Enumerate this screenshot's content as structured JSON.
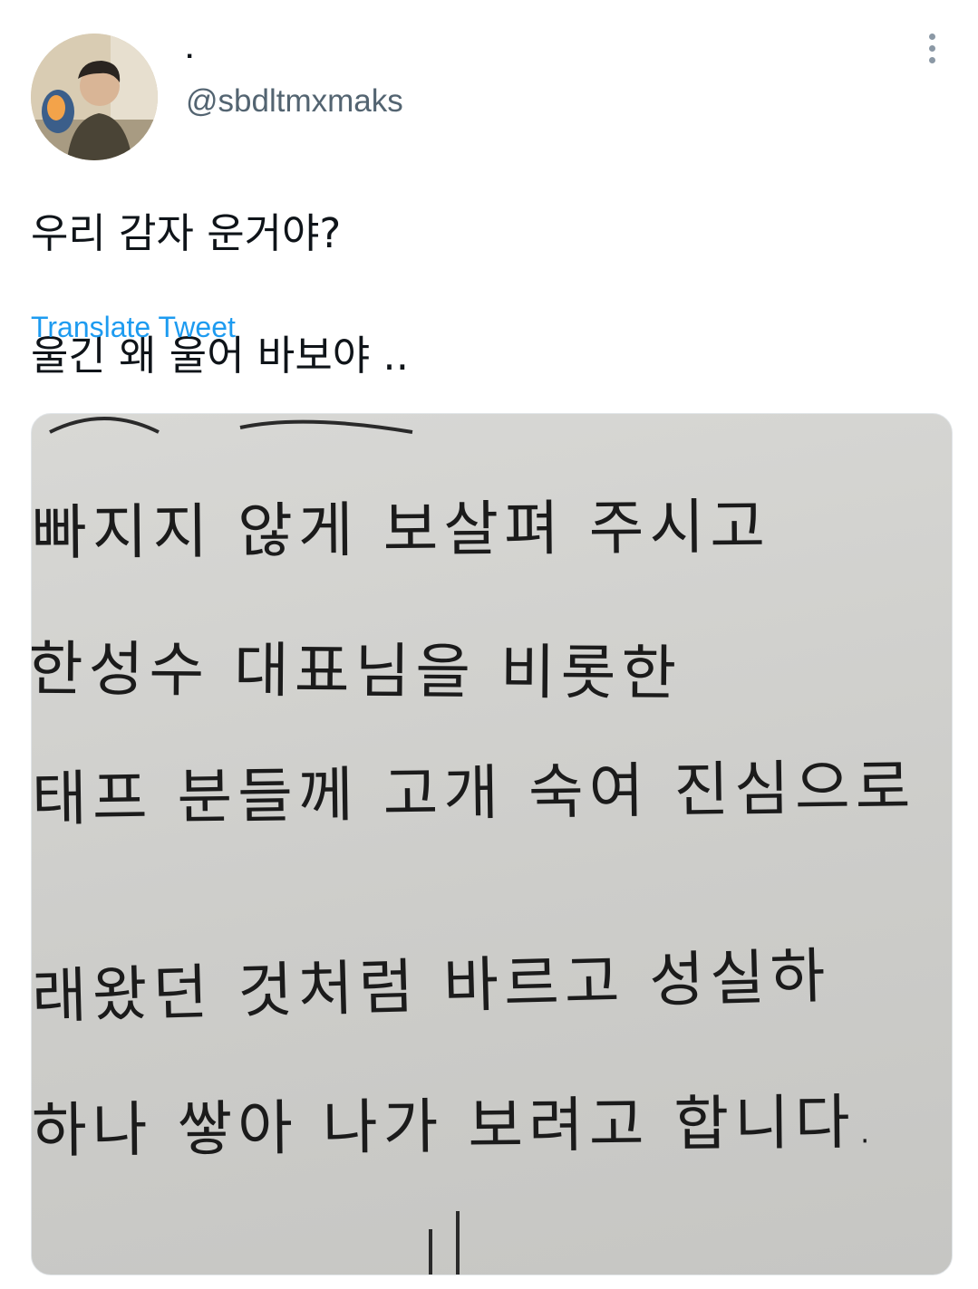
{
  "tweet": {
    "display_name": ".",
    "handle": "@sbdltmxmaks",
    "text_line_1": "우리 감자 운거야?",
    "text_line_2": "울긴 왜 울어 바보야 ..",
    "translate_label": "Translate Tweet"
  },
  "icons": {
    "more": "more-options-icon"
  },
  "media": {
    "lines": [
      "빠지지   않게   보살펴 주시고",
      "한성수   대표님을   비롯한",
      "태프 분들께   고개 숙여   진심으로",
      "래왔던   것처럼   바르고   성실하",
      "하나   쌓아 나가 보려고   합니다."
    ]
  },
  "colors": {
    "link": "#1d9bf0",
    "secondary_text": "#536471",
    "paper": "#d3d3d0"
  }
}
